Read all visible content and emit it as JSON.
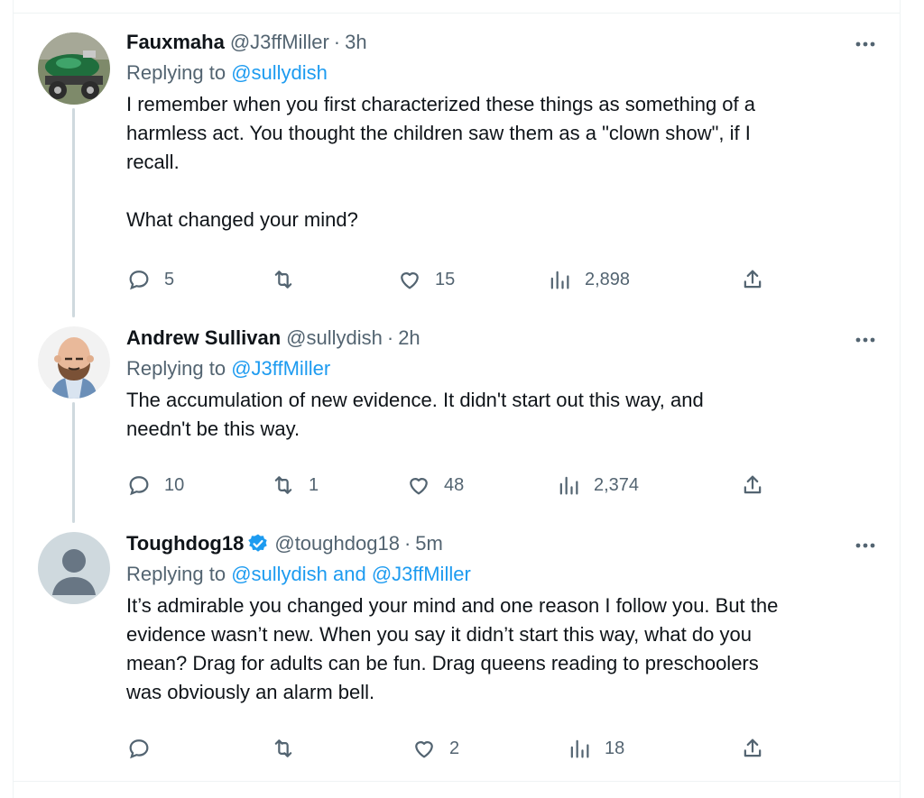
{
  "tweets": [
    {
      "name": "Fauxmaha",
      "handle": "@J3ffMiller",
      "time": "3h",
      "replying_prefix": "Replying to",
      "replying_to": "@sullydish",
      "body": "I remember when you first characterized these things as something of a\nharmless act. You thought the children saw them as a \"clown show\", if I\nrecall.\n\nWhat changed your mind?",
      "replies": "5",
      "retweets": "",
      "likes": "15",
      "views": "2,898"
    },
    {
      "name": "Andrew Sullivan",
      "handle": "@sullydish",
      "time": "2h",
      "replying_prefix": "Replying to",
      "replying_to": "@J3ffMiller",
      "body": "The accumulation of new evidence. It didn't start out this way, and\nneedn't be this way.",
      "replies": "10",
      "retweets": "1",
      "likes": "48",
      "views": "2,374"
    },
    {
      "name": "Toughdog18",
      "handle": "@toughdog18",
      "time": "5m",
      "verified": true,
      "replying_prefix": "Replying to",
      "replying_to": "@sullydish and @J3ffMiller",
      "body": "It’s admirable you changed your mind and one reason I follow you. But the\nevidence wasn’t new. When you say it didn’t start this way, what do you\nmean? Drag for adults can be fun. Drag queens reading to preschoolers\nwas obviously an alarm bell.",
      "replies": "",
      "retweets": "",
      "likes": "2",
      "views": "18"
    }
  ],
  "separator": "·",
  "colors": {
    "text": "#0f1419",
    "secondary": "#536471",
    "link": "#1d9bf0",
    "border": "#eff3f4"
  },
  "icons": [
    "more-icon",
    "reply-icon",
    "retweet-icon",
    "like-icon",
    "views-icon",
    "share-icon",
    "verified-badge-icon",
    "default-avatar-icon"
  ]
}
